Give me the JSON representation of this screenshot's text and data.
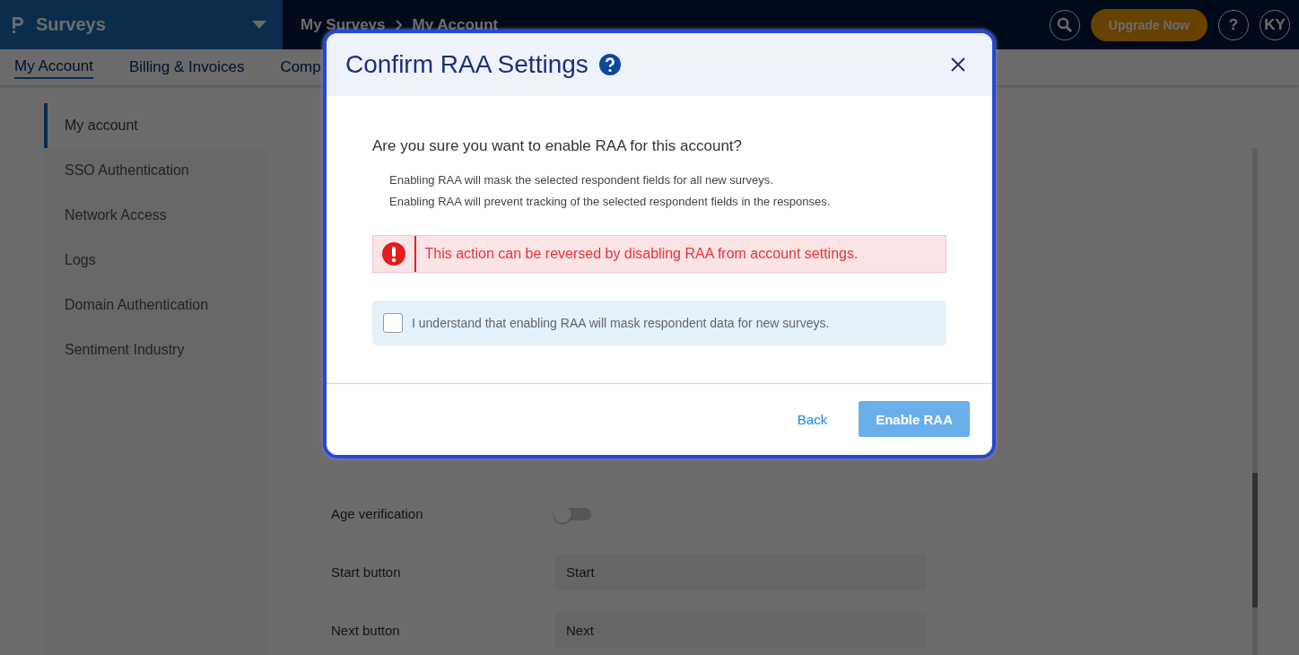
{
  "app": {
    "name": "Surveys"
  },
  "breadcrumb": [
    "My Surveys",
    "My Account"
  ],
  "top_actions": {
    "upgrade": "Upgrade Now",
    "help": "?",
    "avatar": "KY"
  },
  "tabs": [
    {
      "label": "My Account",
      "selected": true
    },
    {
      "label": "Billing & Invoices",
      "selected": false
    },
    {
      "label": "Comp",
      "selected": false
    }
  ],
  "sidebar": {
    "items": [
      {
        "label": "My account",
        "selected": true
      },
      {
        "label": "SSO Authentication",
        "selected": false
      },
      {
        "label": "Network Access",
        "selected": false
      },
      {
        "label": "Logs",
        "selected": false
      },
      {
        "label": "Domain Authentication",
        "selected": false
      },
      {
        "label": "Sentiment Industry",
        "selected": false
      }
    ]
  },
  "settings": [
    {
      "kind": "toggle",
      "label": "Age verification",
      "on": false
    },
    {
      "kind": "field",
      "label": "Start button",
      "value": "Start"
    },
    {
      "kind": "field",
      "label": "Next button",
      "value": "Next"
    }
  ],
  "dialog": {
    "title": "Confirm RAA Settings",
    "question": "Are you sure you want to enable RAA for this account?",
    "notes": [
      "Enabling RAA will mask the selected respondent fields for all new surveys.",
      "Enabling RAA will prevent tracking of the selected respondent fields in the responses."
    ],
    "alert": "This action can be reversed by disabling RAA from account settings.",
    "confirm": {
      "label": "I understand that enabling RAA will mask respondent data for new surveys.",
      "checked": false
    },
    "buttons": {
      "back": "Back",
      "primary": {
        "label": "Enable RAA",
        "disabled": true
      }
    }
  }
}
